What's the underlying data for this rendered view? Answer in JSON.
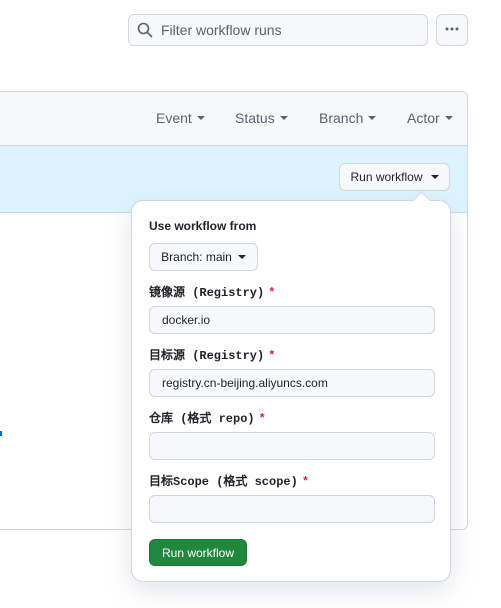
{
  "search": {
    "placeholder": "Filter workflow runs"
  },
  "filters": [
    {
      "label": "Event"
    },
    {
      "label": "Status"
    },
    {
      "label": "Branch"
    },
    {
      "label": "Actor"
    }
  ],
  "banner": {
    "run_button_label": "Run workflow"
  },
  "dropdown": {
    "title": "Use workflow from",
    "branch_label": "Branch: main",
    "inputs": [
      {
        "label": "镜像源 (Registry)",
        "required": "*",
        "value": "docker.io"
      },
      {
        "label": "目标源 (Registry)",
        "required": "*",
        "value": "registry.cn-beijing.aliyuncs.com"
      },
      {
        "label": "仓库 (格式 repo)",
        "required": "*",
        "value": ""
      },
      {
        "label": "目标Scope (格式 scope)",
        "required": "*",
        "value": ""
      }
    ],
    "submit_label": "Run workflow"
  },
  "colors": {
    "primary_green": "#1f883d",
    "banner_blue": "#ddf4ff",
    "required_red": "#cf222e"
  },
  "icons": {
    "search": "search-icon",
    "more": "kebab-horizontal-icon"
  }
}
